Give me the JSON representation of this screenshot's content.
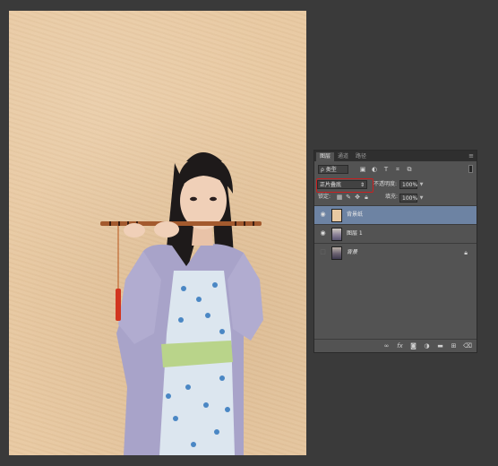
{
  "layers_panel": {
    "tabs": [
      {
        "label": "图层",
        "active": true
      },
      {
        "label": "通道",
        "active": false
      },
      {
        "label": "路径",
        "active": false
      }
    ],
    "filter": {
      "label": "ρ 类型"
    },
    "filter_icons": [
      "image-filter-icon",
      "adjustment-filter-icon",
      "type-filter-icon",
      "shape-filter-icon",
      "smart-object-filter-icon"
    ],
    "blend_mode": {
      "value": "正片叠底"
    },
    "opacity": {
      "label": "不透明度:",
      "value": "100%"
    },
    "lock": {
      "label": "锁定:"
    },
    "fill": {
      "label": "填充:",
      "value": "100%"
    },
    "layers": [
      {
        "name": "背景纸",
        "visible": true,
        "selected": true,
        "locked": false,
        "thumb": "paper"
      },
      {
        "name": "图层 1",
        "visible": true,
        "selected": false,
        "locked": false,
        "thumb": "photo"
      },
      {
        "name": "背景",
        "visible": false,
        "selected": false,
        "locked": true,
        "thumb": "photo-dark"
      }
    ],
    "bottom_icons": [
      "link-icon",
      "fx-icon",
      "mask-icon",
      "adjustment-icon",
      "folder-icon",
      "new-layer-icon",
      "trash-icon"
    ]
  },
  "colors": {
    "panel_bg": "#535353",
    "selection": "#6d83a3",
    "highlight": "#cc1f1f",
    "paper": "#e8c9a2"
  }
}
